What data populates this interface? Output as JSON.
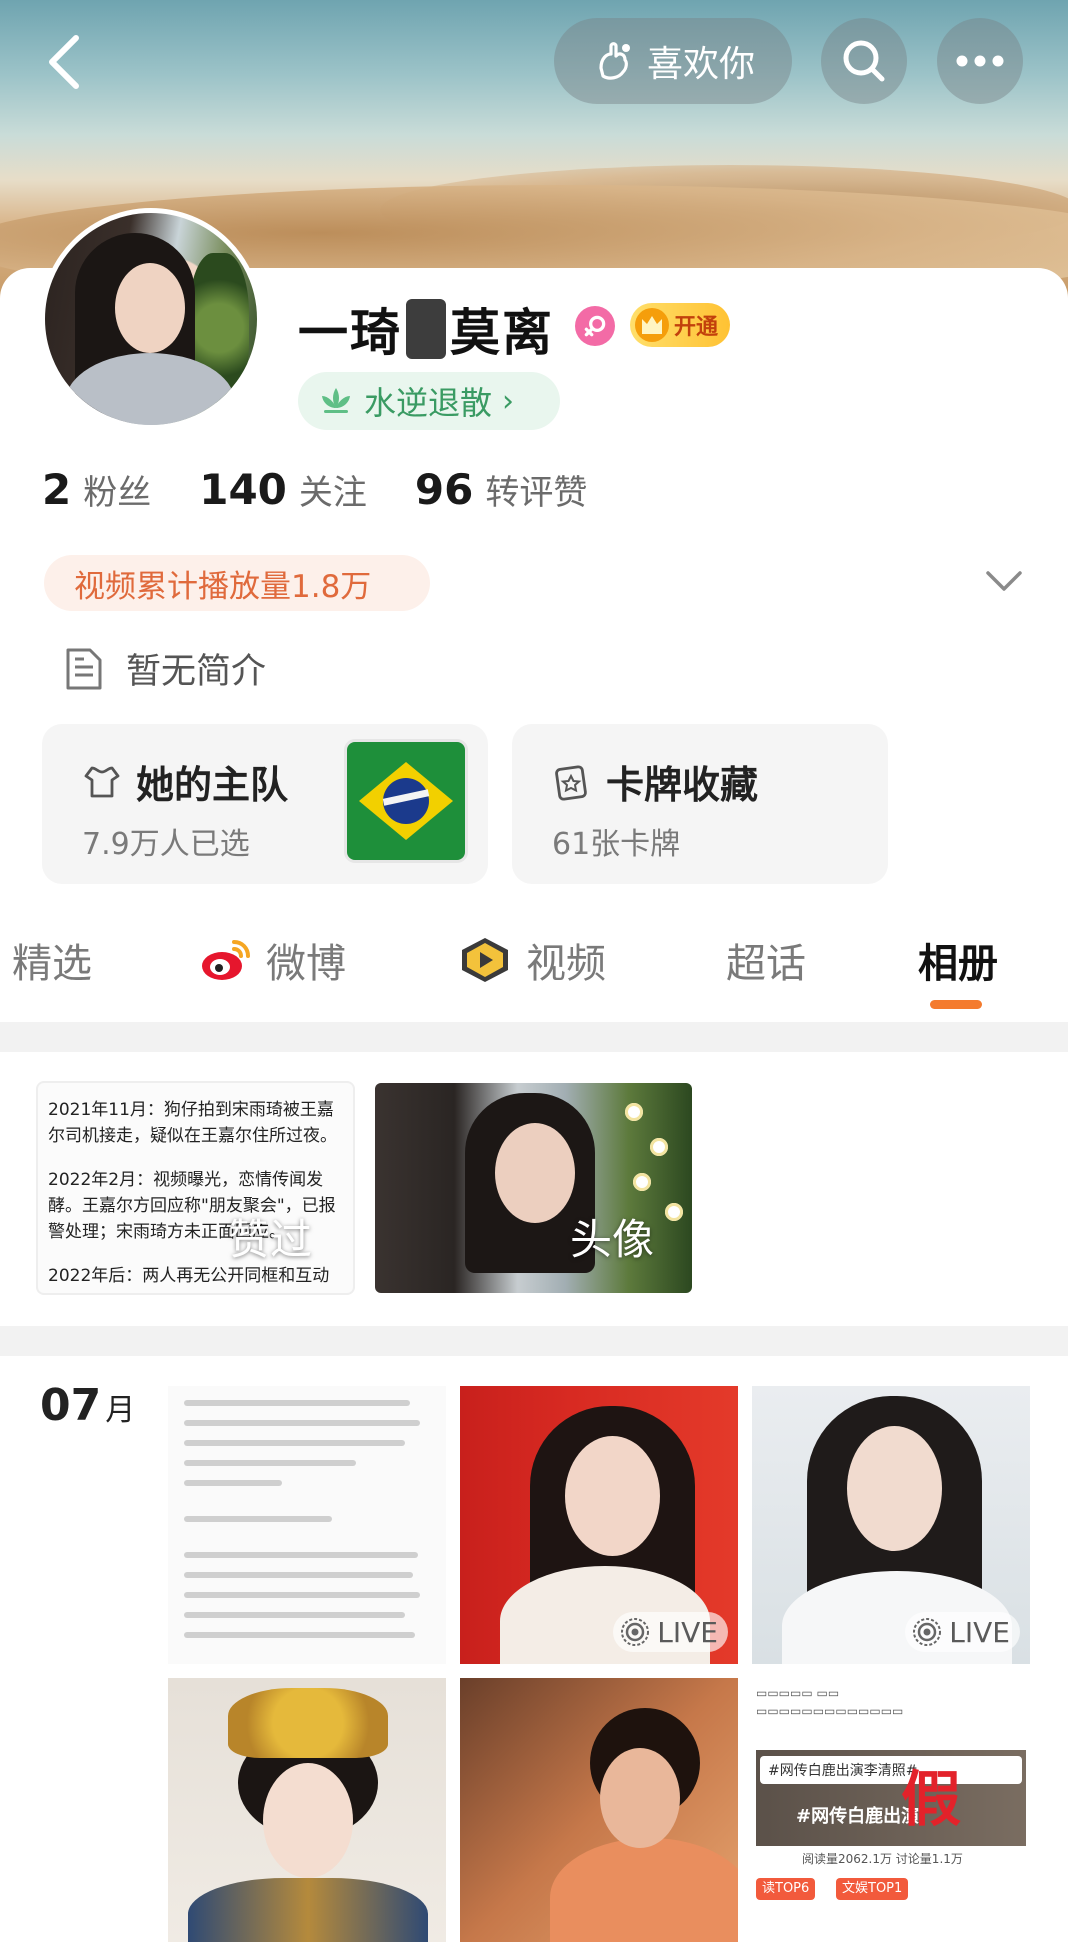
{
  "colors": {
    "accent": "#f47b2e",
    "vip_gold": "#ffc233",
    "level_green": "#3a9b63",
    "video_pill_text": "#e06a3c",
    "gender_pink": "#f36ba6"
  },
  "header": {
    "like_label": "喜欢你"
  },
  "profile": {
    "name_part1": "一",
    "name_part2": "琦",
    "name_part3": "莫离",
    "vip_label": "开通",
    "level_label": "水逆退散",
    "stats": [
      {
        "value": "2",
        "label": "粉丝"
      },
      {
        "value": "140",
        "label": "关注"
      },
      {
        "value": "96",
        "label": "转评赞"
      }
    ],
    "video_plays": "视频累计播放量1.8万",
    "intro": "暂无简介"
  },
  "tiles": {
    "team": {
      "title": "她的主队",
      "sub": "7.9万人已选"
    },
    "cards": {
      "title": "卡牌收藏",
      "sub": "61张卡牌"
    }
  },
  "tabs": [
    {
      "label": "精选",
      "icon": "none"
    },
    {
      "label": "微博",
      "icon": "weibo-icon"
    },
    {
      "label": "视频",
      "icon": "video-icon"
    },
    {
      "label": "超话",
      "icon": "none"
    },
    {
      "label": "相册",
      "icon": "none",
      "active": true
    }
  ],
  "albums": {
    "text_album": {
      "lines": [
        "2021年11月：狗仔拍到宋雨琦被王嘉尔司机接走，疑似在王嘉尔住所过夜。",
        "2022年2月：视频曝光，恋情传闻发酵。王嘉尔方回应称\"朋友聚会\"，已报警处理；宋雨琦方未正面回应。",
        "2022年后：两人再无公开同框和互动"
      ],
      "label": "赞过"
    },
    "photo_album": {
      "label": "头像"
    }
  },
  "month": {
    "num": "07",
    "unit": "月"
  },
  "grid": {
    "live_label": "LIVE",
    "post_tag1": "#网传白鹿出演李清照#",
    "post_tag2": "#网传白鹿出演",
    "post_fake": "假",
    "post_chip1": "读TOP6",
    "post_chip2": "文娱TOP1",
    "post_stats": "阅读量2062.1万 讨论量1.1万"
  }
}
